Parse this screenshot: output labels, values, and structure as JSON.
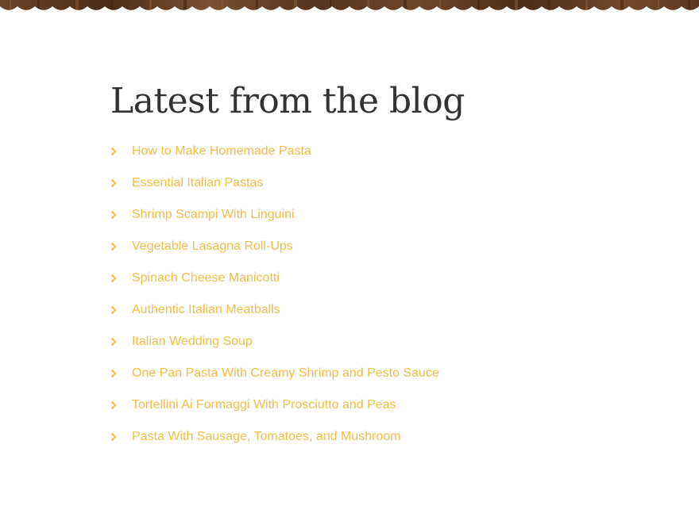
{
  "header": {
    "decoration": "wood-scalloped-border",
    "wood_color": "#5a3a24"
  },
  "blog": {
    "title": "Latest from the blog",
    "link_color": "#f4bd45",
    "chevron_icon": "chevron-right-icon",
    "posts": [
      {
        "label": "How to Make Homemade Pasta"
      },
      {
        "label": "Essential Italian Pastas"
      },
      {
        "label": "Shrimp Scampi With Linguini"
      },
      {
        "label": "Vegetable Lasagna Roll-Ups"
      },
      {
        "label": "Spinach Cheese Manicotti"
      },
      {
        "label": "Authentic Italian Meatballs"
      },
      {
        "label": "Italian Wedding Soup"
      },
      {
        "label": "One Pan Pasta With Creamy Shrimp and Pesto Sauce"
      },
      {
        "label": "Tortellini Ai Formaggi With Prosciutto and Peas"
      },
      {
        "label": "Pasta With Sausage, Tomatoes, and Mushroom"
      }
    ]
  }
}
